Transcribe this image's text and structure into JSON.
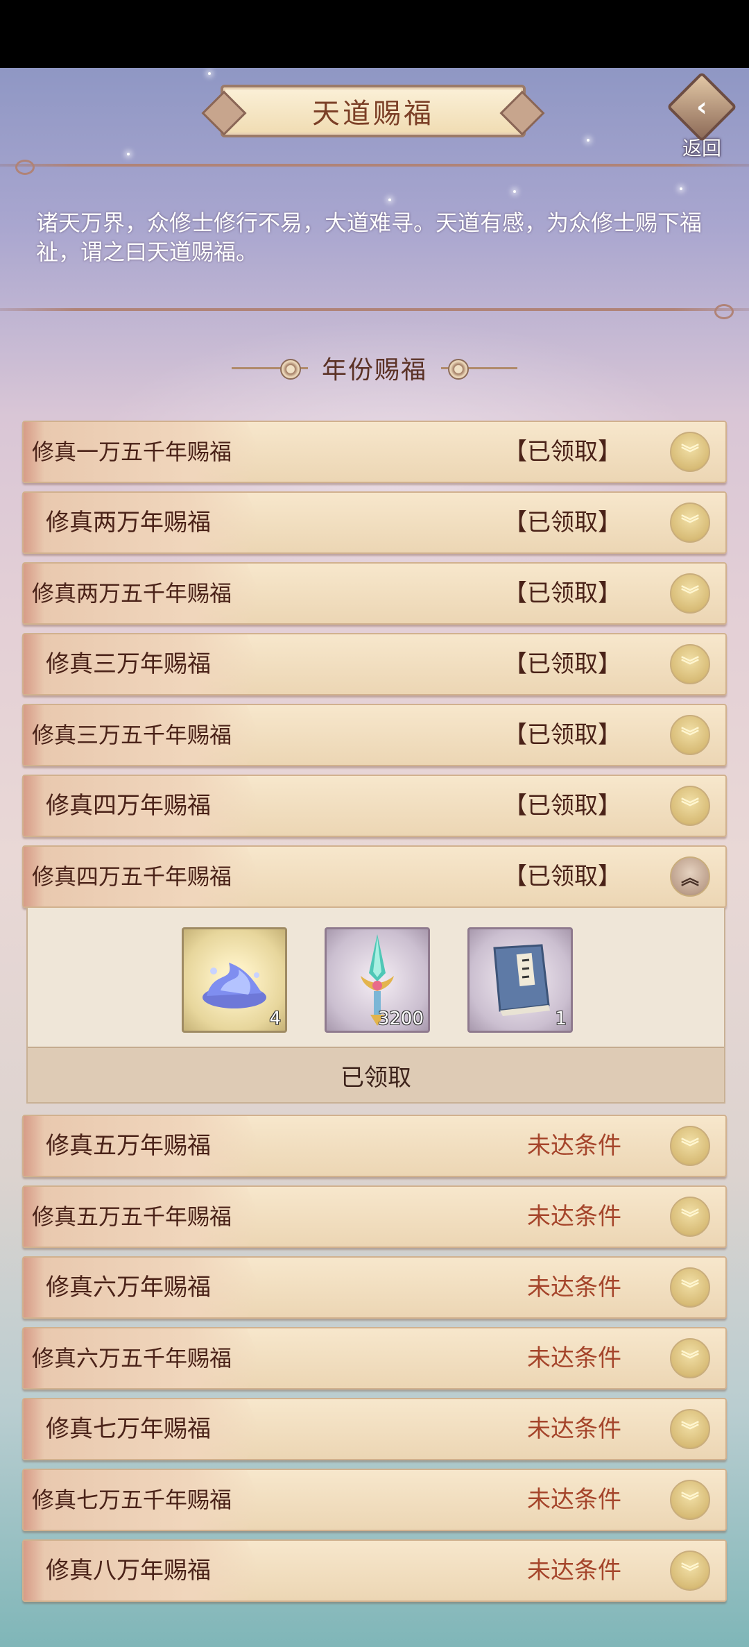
{
  "header": {
    "title": "天道赐福",
    "back_label": "返回"
  },
  "intro": "诸天万界，众修士修行不易，大道难寻。天道有感，为众修士赐下福祉，谓之曰天道赐福。",
  "section_title": "年份赐福",
  "rows": [
    {
      "label": "修真一万五千年赐福",
      "status": "【已领取】"
    },
    {
      "label": "修真两万年赐福",
      "status": "【已领取】"
    },
    {
      "label": "修真两万五千年赐福",
      "status": "【已领取】"
    },
    {
      "label": "修真三万年赐福",
      "status": "【已领取】"
    },
    {
      "label": "修真三万五千年赐福",
      "status": "【已领取】"
    },
    {
      "label": "修真四万年赐福",
      "status": "【已领取】"
    },
    {
      "label": "修真四万五千年赐福",
      "status": "【已领取】"
    },
    {
      "label": "修真五万年赐福",
      "status": "未达条件"
    },
    {
      "label": "修真五万五千年赐福",
      "status": "未达条件"
    },
    {
      "label": "修真六万年赐福",
      "status": "未达条件"
    },
    {
      "label": "修真六万五千年赐福",
      "status": "未达条件"
    },
    {
      "label": "修真七万年赐福",
      "status": "未达条件"
    },
    {
      "label": "修真七万五千年赐福",
      "status": "未达条件"
    },
    {
      "label": "修真八万年赐福",
      "status": "未达条件"
    }
  ],
  "expanded": {
    "rewards": [
      {
        "icon": "water-spirit-icon",
        "count": "4"
      },
      {
        "icon": "jade-sword-icon",
        "count": "3200"
      },
      {
        "icon": "book-icon",
        "count": "1"
      }
    ],
    "claimed_label": "已领取"
  },
  "colors": {
    "claimed_text": "#4a2218",
    "pending_text": "#a5452b"
  }
}
